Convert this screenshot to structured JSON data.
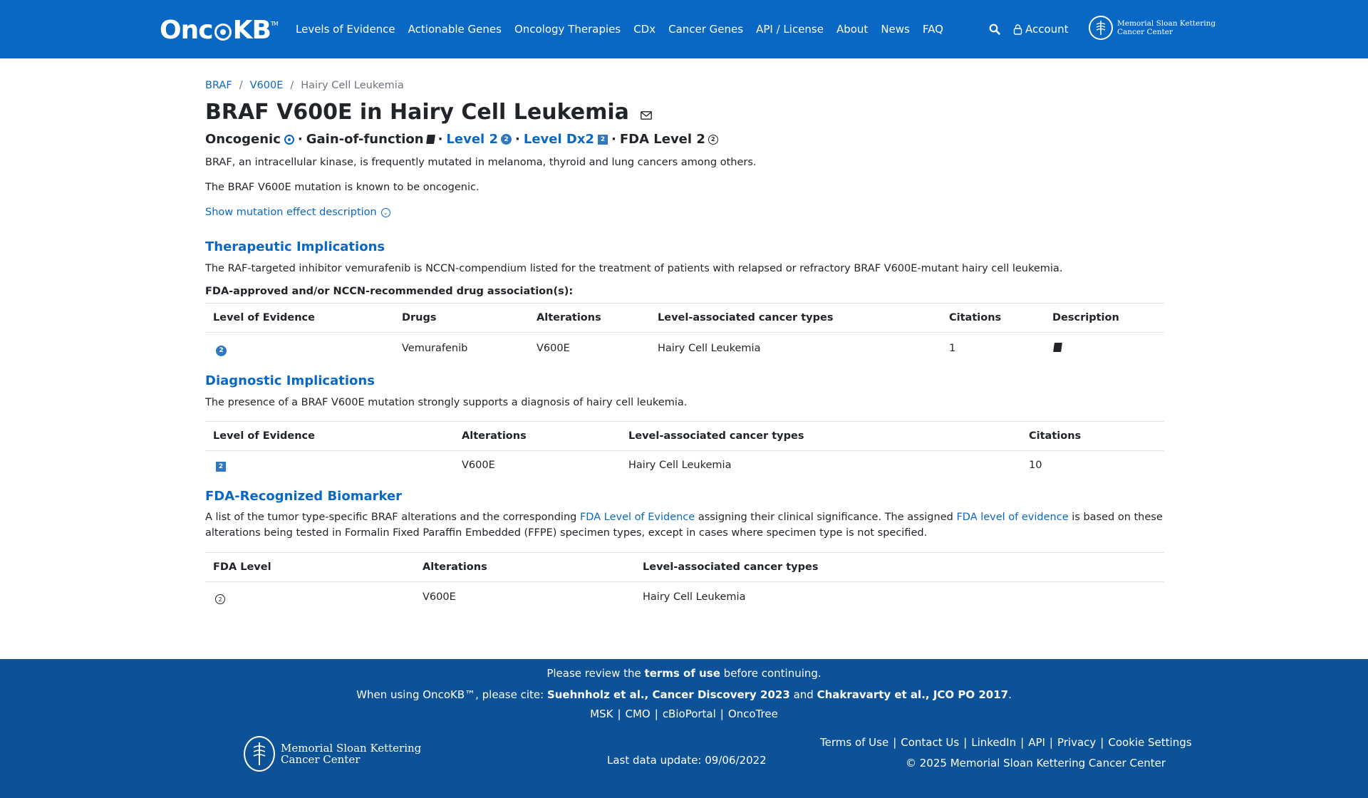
{
  "nav": {
    "logo": "OncoKB",
    "items": [
      "Levels of Evidence",
      "Actionable Genes",
      "Oncology Therapies",
      "CDx",
      "Cancer Genes",
      "API / License",
      "About",
      "News",
      "FAQ"
    ],
    "account": "Account",
    "msk_logo": [
      "Memorial Sloan Kettering",
      "Cancer Center"
    ]
  },
  "breadcrumb": [
    "BRAF",
    "V600E",
    "Hairy Cell Leukemia"
  ],
  "title": "BRAF V600E in Hairy Cell Leukemia",
  "summary": {
    "oncogenic": "Oncogenic",
    "effect": "Gain-of-function",
    "level": "Level 2",
    "level_badge": "2",
    "dx_level": "Level Dx2",
    "dx_badge": "2",
    "fda_level": "FDA Level 2",
    "fda_badge": "2"
  },
  "gene_desc": "BRAF, an intracellular kinase, is frequently mutated in melanoma, thyroid and lung cancers among others.",
  "mutation_desc": "The BRAF V600E mutation is known to be oncogenic.",
  "show_effect": "Show mutation effect description",
  "therapeutic": {
    "title": "Therapeutic Implications",
    "desc": "The RAF-targeted inhibitor vemurafenib is NCCN-compendium listed for the treatment of patients with relapsed or refractory BRAF V600E-mutant hairy cell leukemia.",
    "subtitle": "FDA-approved and/or NCCN-recommended drug association(s):",
    "headers": [
      "Level of Evidence",
      "Drugs",
      "Alterations",
      "Level-associated cancer types",
      "Citations",
      "Description"
    ],
    "row": {
      "level": "2",
      "drugs": "Vemurafenib",
      "alteration": "V600E",
      "cancer": "Hairy Cell Leukemia",
      "citations": "1"
    }
  },
  "diagnostic": {
    "title": "Diagnostic Implications",
    "desc": "The presence of a BRAF V600E mutation strongly supports a diagnosis of hairy cell leukemia.",
    "headers": [
      "Level of Evidence",
      "Alterations",
      "Level-associated cancer types",
      "Citations"
    ],
    "row": {
      "level": "2",
      "alteration": "V600E",
      "cancer": "Hairy Cell Leukemia",
      "citations": "10"
    }
  },
  "fda": {
    "title": "FDA-Recognized Biomarker",
    "desc_1": "A list of the tumor type-specific BRAF alterations and the corresponding",
    "link_1": "FDA Level of Evidence",
    "desc_2": "assigning their clinical significance. The assigned",
    "link_2": "FDA level of evidence",
    "desc_3": "is based on these alterations being tested in Formalin Fixed Paraffin Embedded (FFPE) specimen types, except in cases where specimen type is not specified.",
    "headers": [
      "FDA Level",
      "Alterations",
      "Level-associated cancer types"
    ],
    "row": {
      "level": "2",
      "alteration": "V600E",
      "cancer": "Hairy Cell Leukemia"
    }
  },
  "footer": {
    "review_1": "Please review the",
    "review_terms": "terms of use",
    "review_2": "before continuing.",
    "cite_1": "When using OncoKB™, please cite:",
    "cite_ref1": "Suehnholz et al., Cancer Discovery 2023",
    "cite_and": "and",
    "cite_ref2": "Chakravarty et al., JCO PO 2017",
    "cite_end": ".",
    "links": [
      "MSK",
      "CMO",
      "cBioPortal",
      "OncoTree"
    ],
    "msk_logo": [
      "Memorial Sloan Kettering",
      "Cancer Center"
    ],
    "last_update": "Last data update: 09/06/2022",
    "right_links": [
      "Terms of Use",
      "Contact Us",
      "LinkedIn",
      "API",
      "Privacy",
      "Cookie Settings"
    ],
    "copyright": "© 2025 Memorial Sloan Kettering Cancer Center"
  }
}
